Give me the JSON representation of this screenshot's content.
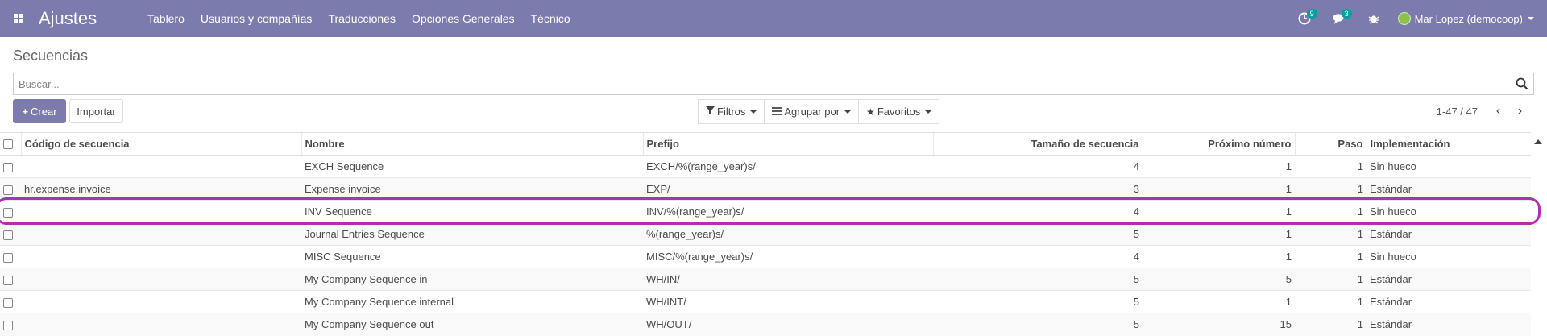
{
  "navbar": {
    "brand": "Ajustes",
    "menu": [
      "Tablero",
      "Usuarios y compañías",
      "Traducciones",
      "Opciones Generales",
      "Técnico"
    ],
    "activity_count": "9",
    "messages_count": "3",
    "user_name": "Mar Lopez (democoop)",
    "colors": {
      "bar": "#7c7bad",
      "badge": "#00a09d"
    }
  },
  "control": {
    "breadcrumb": "Secuencias",
    "search_placeholder": "Buscar...",
    "create_label": "Crear",
    "import_label": "Importar",
    "filters_label": "Filtros",
    "groupby_label": "Agrupar por",
    "favorites_label": "Favoritos",
    "pager_text": "1-47 / 47"
  },
  "table": {
    "columns": [
      "Código de secuencia",
      "Nombre",
      "Prefijo",
      "Tamaño de secuencia",
      "Próximo número",
      "Paso",
      "Implementación"
    ],
    "rows": [
      {
        "code": "",
        "name": "EXCH Sequence",
        "prefix": "EXCH/%(range_year)s/",
        "size": "4",
        "next": "1",
        "step": "1",
        "impl": "Sin hueco"
      },
      {
        "code": "hr.expense.invoice",
        "name": "Expense invoice",
        "prefix": "EXP/",
        "size": "3",
        "next": "1",
        "step": "1",
        "impl": "Estándar"
      },
      {
        "code": "",
        "name": "INV Sequence",
        "prefix": "INV/%(range_year)s/",
        "size": "4",
        "next": "1",
        "step": "1",
        "impl": "Sin hueco"
      },
      {
        "code": "",
        "name": "Journal Entries Sequence",
        "prefix": "%(range_year)s/",
        "size": "5",
        "next": "1",
        "step": "1",
        "impl": "Estándar"
      },
      {
        "code": "",
        "name": "MISC Sequence",
        "prefix": "MISC/%(range_year)s/",
        "size": "4",
        "next": "1",
        "step": "1",
        "impl": "Sin hueco"
      },
      {
        "code": "",
        "name": "My Company Sequence in",
        "prefix": "WH/IN/",
        "size": "5",
        "next": "5",
        "step": "1",
        "impl": "Estándar"
      },
      {
        "code": "",
        "name": "My Company Sequence internal",
        "prefix": "WH/INT/",
        "size": "5",
        "next": "1",
        "step": "1",
        "impl": "Estándar"
      },
      {
        "code": "",
        "name": "My Company Sequence out",
        "prefix": "WH/OUT/",
        "size": "5",
        "next": "15",
        "step": "1",
        "impl": "Estándar"
      }
    ]
  },
  "highlight": {
    "row_index": 2,
    "color": "#b030b0"
  }
}
